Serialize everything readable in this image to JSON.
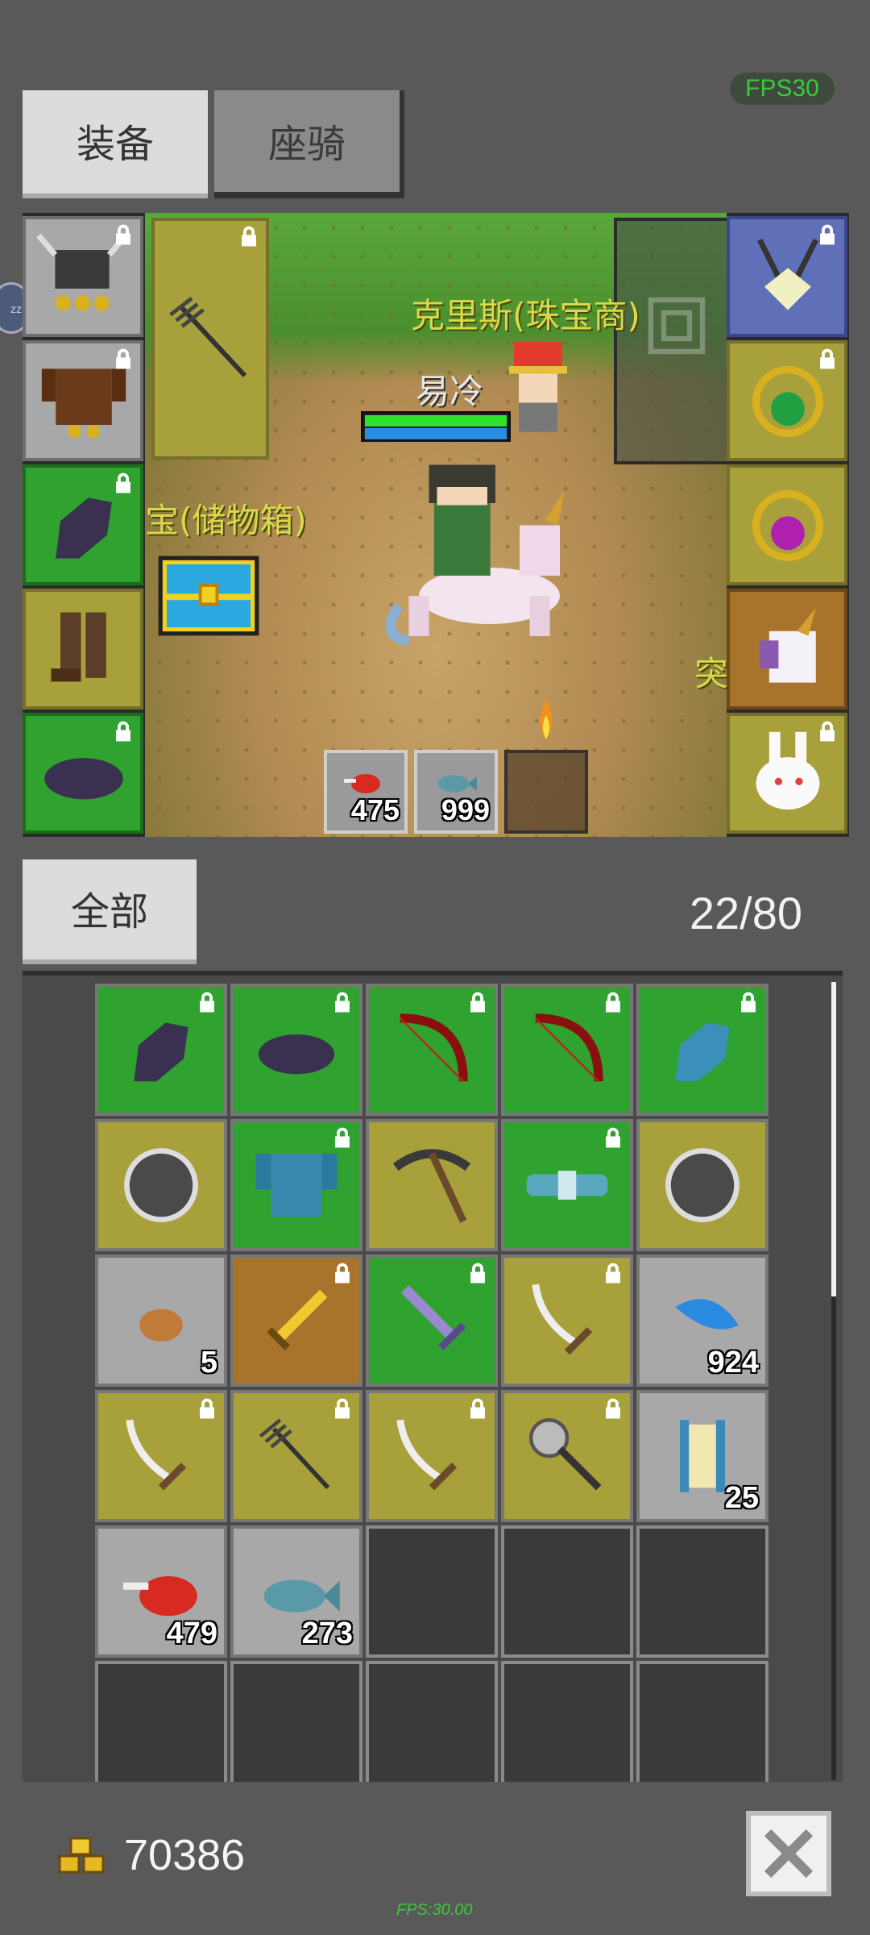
{
  "fps_badge": "FPS30",
  "tabs": {
    "equipment": "装备",
    "mount": "座骑"
  },
  "scene": {
    "npc_label": "克里斯(珠宝商)",
    "player_name": "易冷",
    "chest_label": "宝(储物箱)",
    "edge_text": "突"
  },
  "equipment_slots": {
    "left": [
      {
        "icon": "horned-helmet-icon",
        "rarity": "gray"
      },
      {
        "icon": "leather-armor-icon",
        "rarity": "gray"
      },
      {
        "icon": "gauntlet-icon",
        "rarity": "green"
      },
      {
        "icon": "boots-icon",
        "rarity": "yellow"
      },
      {
        "icon": "cap-icon",
        "rarity": "green"
      }
    ],
    "weapon": {
      "icon": "trident-icon",
      "rarity": "yellow"
    },
    "right": [
      {
        "icon": "amulet-icon",
        "rarity": "blue"
      },
      {
        "icon": "emerald-ring-icon",
        "rarity": "yellow"
      },
      {
        "icon": "amethyst-ring-icon",
        "rarity": "yellow"
      },
      {
        "icon": "unicorn-pet-icon",
        "rarity": "orange"
      },
      {
        "icon": "rabbit-pet-icon",
        "rarity": "yellow"
      }
    ]
  },
  "quickbar": [
    {
      "icon": "meat-icon",
      "count": "475"
    },
    {
      "icon": "fish-icon",
      "count": "999"
    },
    {
      "icon": "empty-slot",
      "count": ""
    }
  ],
  "bag": {
    "filter_label": "全部",
    "capacity": "22/80",
    "items": [
      {
        "icon": "gauntlet-icon",
        "rarity": "green",
        "locked": true,
        "count": ""
      },
      {
        "icon": "cap-icon",
        "rarity": "green",
        "locked": true,
        "count": ""
      },
      {
        "icon": "red-bow-icon",
        "rarity": "green",
        "locked": true,
        "count": ""
      },
      {
        "icon": "red-bow-icon",
        "rarity": "green",
        "locked": true,
        "count": ""
      },
      {
        "icon": "blue-gauntlet-icon",
        "rarity": "green",
        "locked": true,
        "count": ""
      },
      {
        "icon": "round-shield-icon",
        "rarity": "yellow",
        "locked": false,
        "count": ""
      },
      {
        "icon": "chainmail-icon",
        "rarity": "green",
        "locked": true,
        "count": ""
      },
      {
        "icon": "pickaxe-icon",
        "rarity": "yellow",
        "locked": false,
        "count": ""
      },
      {
        "icon": "belt-icon",
        "rarity": "green",
        "locked": true,
        "count": ""
      },
      {
        "icon": "round-shield-icon",
        "rarity": "yellow",
        "locked": false,
        "count": ""
      },
      {
        "icon": "ore-icon",
        "rarity": "gray",
        "locked": false,
        "count": "5"
      },
      {
        "icon": "golden-dagger-icon",
        "rarity": "orange",
        "locked": true,
        "count": ""
      },
      {
        "icon": "crystal-sword-icon",
        "rarity": "green",
        "locked": true,
        "count": ""
      },
      {
        "icon": "saber-icon",
        "rarity": "yellow",
        "locked": true,
        "count": ""
      },
      {
        "icon": "blue-feather-icon",
        "rarity": "gray",
        "locked": false,
        "count": "924"
      },
      {
        "icon": "saber-icon",
        "rarity": "yellow",
        "locked": true,
        "count": ""
      },
      {
        "icon": "trident-icon",
        "rarity": "yellow",
        "locked": true,
        "count": ""
      },
      {
        "icon": "saber-icon",
        "rarity": "yellow",
        "locked": true,
        "count": ""
      },
      {
        "icon": "mace-icon",
        "rarity": "yellow",
        "locked": true,
        "count": ""
      },
      {
        "icon": "scroll-icon",
        "rarity": "gray",
        "locked": false,
        "count": "25"
      },
      {
        "icon": "meat-icon",
        "rarity": "gray",
        "locked": false,
        "count": "479"
      },
      {
        "icon": "fish-icon",
        "rarity": "gray",
        "locked": false,
        "count": "273"
      },
      {
        "icon": "empty-slot",
        "rarity": "empty",
        "locked": false,
        "count": ""
      },
      {
        "icon": "empty-slot",
        "rarity": "empty",
        "locked": false,
        "count": ""
      },
      {
        "icon": "empty-slot",
        "rarity": "empty",
        "locked": false,
        "count": ""
      },
      {
        "icon": "empty-slot",
        "rarity": "empty",
        "locked": false,
        "count": ""
      },
      {
        "icon": "empty-slot",
        "rarity": "empty",
        "locked": false,
        "count": ""
      },
      {
        "icon": "empty-slot",
        "rarity": "empty",
        "locked": false,
        "count": ""
      },
      {
        "icon": "empty-slot",
        "rarity": "empty",
        "locked": false,
        "count": ""
      },
      {
        "icon": "empty-slot",
        "rarity": "empty",
        "locked": false,
        "count": ""
      }
    ]
  },
  "footer": {
    "gold": "70386",
    "fps_text": "FPS:30.00",
    "close_icon": "close-icon"
  },
  "colors": {
    "green": "#2fa22f",
    "yellow": "#a8a03a",
    "gray": "#a8a8a8",
    "orange": "#a8732a",
    "blue": "#5f6fb8",
    "empty": "#3a3a3a",
    "background": "#595959"
  }
}
